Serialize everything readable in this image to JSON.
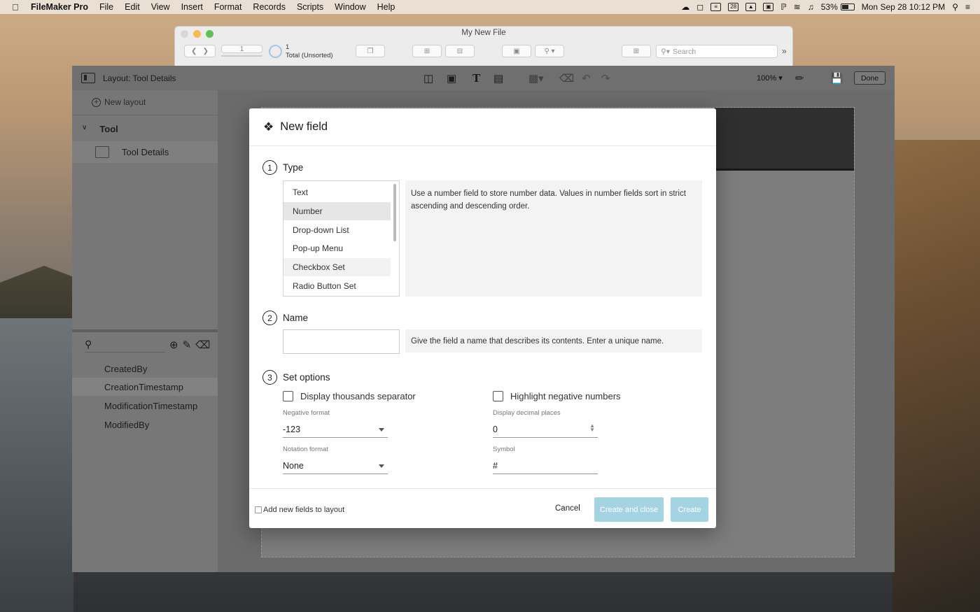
{
  "menubar": {
    "app": "FileMaker Pro",
    "items": [
      "File",
      "Edit",
      "View",
      "Insert",
      "Format",
      "Records",
      "Scripts",
      "Window",
      "Help"
    ],
    "battery": "53%",
    "datetime": "Mon Sep 28  10:12 PM",
    "calendar_day": "28"
  },
  "filewin": {
    "title": "My New File",
    "record_number": "1",
    "record_count": "1",
    "total_label": "Total (Unsorted)",
    "search_placeholder": "Search"
  },
  "layout": {
    "name_label": "Layout: Tool Details",
    "zoom": "100%",
    "done_label": "Done",
    "new_layout_label": "New layout",
    "group_name": "Tool",
    "current_layout": "Tool Details",
    "fields": [
      "CreatedBy",
      "CreationTimestamp",
      "ModificationTimestamp",
      "ModifiedBy"
    ],
    "selected_field": "CreationTimestamp"
  },
  "dialog": {
    "title": "New field",
    "step1": {
      "num": "1",
      "label": "Type"
    },
    "types": [
      "Text",
      "Number",
      "Drop-down List",
      "Pop-up Menu",
      "Checkbox Set",
      "Radio Button Set"
    ],
    "selected_type": "Number",
    "type_description": "Use a number field to store number data. Values in number fields sort in strict ascending and descending order.",
    "step2": {
      "num": "2",
      "label": "Name"
    },
    "name_value": "",
    "name_description": "Give the field a name that describes its contents. Enter a unique name.",
    "step3": {
      "num": "3",
      "label": "Set options"
    },
    "display_thousands_label": "Display thousands separator",
    "highlight_negative_label": "Highlight negative numbers",
    "negative_format_label": "Negative format",
    "negative_format_value": "-123",
    "decimal_places_label": "Display decimal places",
    "decimal_places_value": "0",
    "notation_format_label": "Notation format",
    "notation_format_value": "None",
    "symbol_label": "Symbol",
    "symbol_value": "#",
    "add_to_layout_label": "Add new fields to layout",
    "cancel_label": "Cancel",
    "create_close_label": "Create and close",
    "create_label": "Create"
  },
  "colors": {
    "primary_button": "#a4d4e1",
    "selection": "#e6e6e6"
  }
}
